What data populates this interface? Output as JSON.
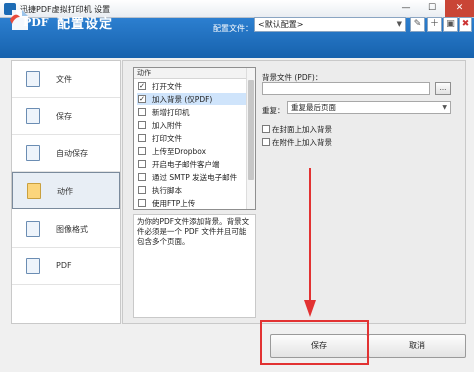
{
  "window": {
    "title": "迅捷PDF虚拟打印机 设置",
    "min": "—",
    "max": "☐",
    "close": "✕"
  },
  "header": {
    "logo_text": "PDF",
    "title": "配置设定",
    "config_label": "配置文件：",
    "config_value": "<默认配置>"
  },
  "nav": {
    "items": [
      {
        "label": "文件",
        "icon": "file-icon"
      },
      {
        "label": "保存",
        "icon": "save-icon"
      },
      {
        "label": "自动保存",
        "icon": "auto-save-icon"
      },
      {
        "label": "动作",
        "icon": "action-icon",
        "selected": true
      },
      {
        "label": "图像格式",
        "icon": "image-format-icon"
      },
      {
        "label": "PDF",
        "icon": "pdf-icon"
      }
    ]
  },
  "actions": {
    "header": "动作",
    "items": [
      {
        "label": "打开文件",
        "checked": true
      },
      {
        "label": "加入背景 (仅PDF)",
        "checked": true,
        "highlight": true
      },
      {
        "label": "新增打印机",
        "checked": false
      },
      {
        "label": "加入附件",
        "checked": false
      },
      {
        "label": "打印文件",
        "checked": false
      },
      {
        "label": "上传至Dropbox",
        "checked": false
      },
      {
        "label": "开启电子邮件客户端",
        "checked": false
      },
      {
        "label": "通过 SMTP 发送电子邮件",
        "checked": false
      },
      {
        "label": "执行脚本",
        "checked": false
      },
      {
        "label": "使用FTP上传",
        "checked": false
      }
    ],
    "description": "为你的PDF文件添加背景。背景文件必须是一个 PDF 文件并且可能包含多个页面。"
  },
  "settings": {
    "bgfile_label": "背景文件 (PDF)：",
    "bgfile_value": "",
    "browse_label": "...",
    "repeat_label": "重复：",
    "repeat_value": "重复最后页面",
    "opt_cover": "在封面上加入背景",
    "opt_attach": "在附件上加入背景"
  },
  "buttons": {
    "save": "保存",
    "cancel": "取消"
  },
  "colors": {
    "header_blue": "#1e6fbf",
    "highlight_red": "#e23232"
  }
}
